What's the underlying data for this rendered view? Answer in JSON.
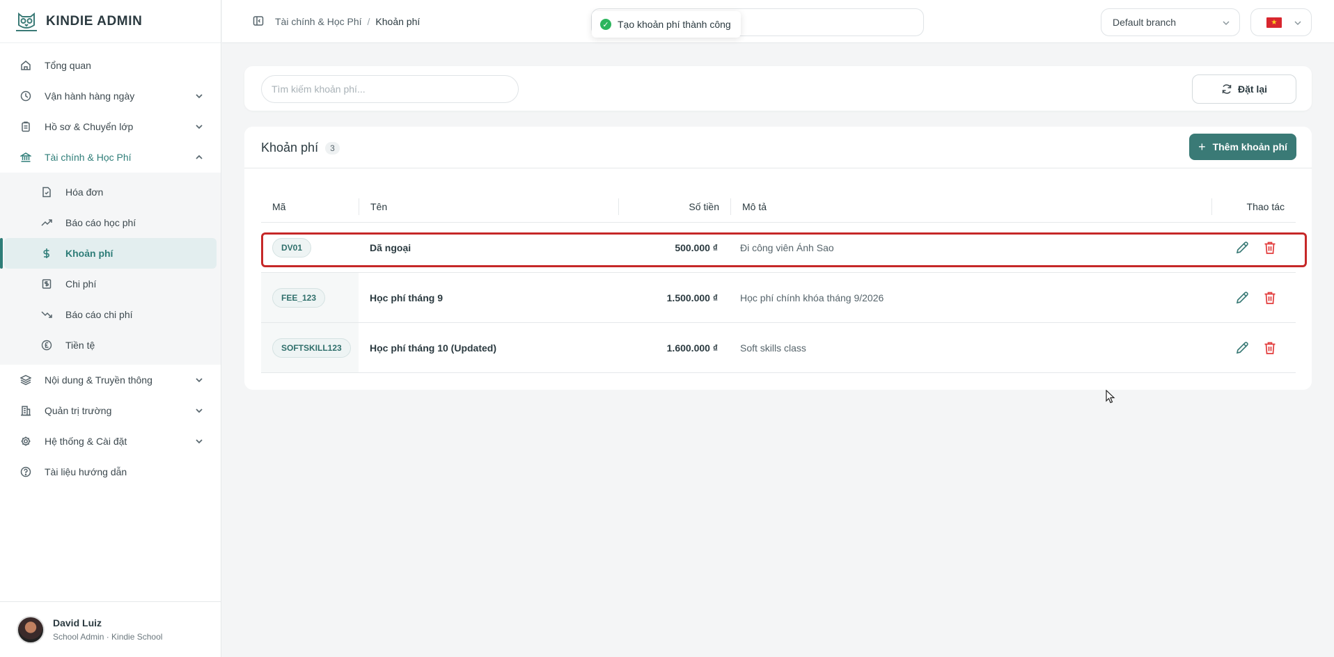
{
  "brand": {
    "title": "KINDIE ADMIN"
  },
  "sidebar": {
    "items": [
      {
        "label": "Tổng quan",
        "icon": "home-icon"
      },
      {
        "label": "Vận hành hàng ngày",
        "icon": "clock-icon"
      },
      {
        "label": "Hồ sơ & Chuyển lớp",
        "icon": "clipboard-icon"
      },
      {
        "label": "Tài chính & Học Phí",
        "icon": "bank-icon"
      },
      {
        "label": "Nội dung & Truyền thông",
        "icon": "layers-icon"
      },
      {
        "label": "Quản trị trường",
        "icon": "building-icon"
      },
      {
        "label": "Hệ thống & Cài đặt",
        "icon": "gear-icon"
      },
      {
        "label": "Tài liệu hướng dẫn",
        "icon": "help-icon"
      }
    ],
    "finance_sub": [
      {
        "label": "Hóa đơn",
        "icon": "invoice-icon"
      },
      {
        "label": "Báo cáo học phí",
        "icon": "trend-up-icon"
      },
      {
        "label": "Khoản phí",
        "icon": "dollar-icon"
      },
      {
        "label": "Chi phí",
        "icon": "receipt-icon"
      },
      {
        "label": "Báo cáo chi phí",
        "icon": "trend-down-icon"
      },
      {
        "label": "Tiền tệ",
        "icon": "currency-icon"
      }
    ]
  },
  "user": {
    "name": "David Luiz",
    "role": "School Admin · Kindie School"
  },
  "header": {
    "breadcrumb": [
      "Tài chính & Học Phí",
      "Khoản phí"
    ],
    "branch": "Default branch",
    "toast": "Tạo khoản phí thành công"
  },
  "filter": {
    "search_placeholder": "Tìm kiếm khoản phí...",
    "reset_label": "Đặt lại"
  },
  "table": {
    "title": "Khoản phí",
    "count": "3",
    "add_label": "Thêm khoản phí",
    "columns": {
      "code": "Mã",
      "name": "Tên",
      "amount": "Số tiền",
      "desc": "Mô tả",
      "actions": "Thao tác"
    },
    "rows": [
      {
        "code": "DV01",
        "name": "Dã ngoại",
        "amount": "500.000 ₫",
        "desc": "Đi công viên Ánh Sao"
      },
      {
        "code": "FEE_123",
        "name": "Học phí tháng 9",
        "amount": "1.500.000 ₫",
        "desc": "Học phí chính khóa tháng 9/2026"
      },
      {
        "code": "SOFTSKILL123",
        "name": "Học phí tháng 10 (Updated)",
        "amount": "1.600.000 ₫",
        "desc": "Soft skills class"
      }
    ]
  },
  "colors": {
    "accent": "#3a7a76",
    "danger": "#e23b3b",
    "highlight": "#c62828",
    "success": "#2db55d"
  }
}
